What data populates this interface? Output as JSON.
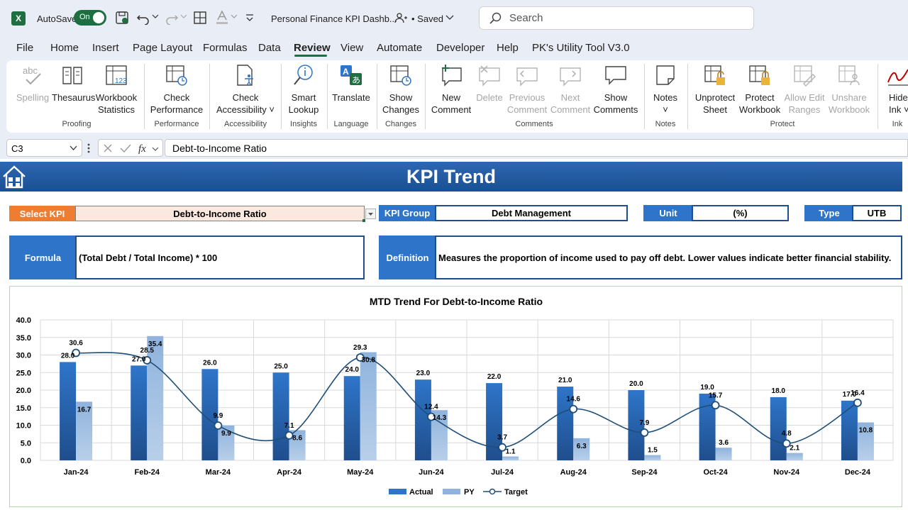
{
  "titlebar": {
    "autosave_label": "AutoSave",
    "toggle_label": "On",
    "file_title": "Personal Finance KPI Dashb...",
    "saved_label": "• Saved",
    "search_placeholder": "Search"
  },
  "menu": {
    "file": "File",
    "home": "Home",
    "insert": "Insert",
    "page_layout": "Page Layout",
    "formulas": "Formulas",
    "data": "Data",
    "review": "Review",
    "view": "View",
    "automate": "Automate",
    "developer": "Developer",
    "help": "Help",
    "utility": "PK's Utility Tool V3.0"
  },
  "ribbon": {
    "spelling": "Spelling",
    "thesaurus": "Thesaurus",
    "workbook_stats_1": "Workbook",
    "workbook_stats_2": "Statistics",
    "check_perf_1": "Check",
    "check_perf_2": "Performance",
    "check_acc_1": "Check",
    "check_acc_2": "Accessibility ˅",
    "smart_1": "Smart",
    "smart_2": "Lookup",
    "translate": "Translate",
    "show_changes_1": "Show",
    "show_changes_2": "Changes",
    "new_comment_1": "New",
    "new_comment_2": "Comment",
    "delete": "Delete",
    "previous_1": "Previous",
    "previous_2": "Comment",
    "next_1": "Next",
    "next_2": "Comment",
    "show_comments_1": "Show",
    "show_comments_2": "Comments",
    "notes_1": "Notes",
    "notes_2": "˅",
    "unprotect_1": "Unprotect",
    "unprotect_2": "Sheet",
    "protect_wb_1": "Protect",
    "protect_wb_2": "Workbook",
    "allow_edit_1": "Allow Edit",
    "allow_edit_2": "Ranges",
    "unshare_1": "Unshare",
    "unshare_2": "Workbook",
    "hide_ink_1": "Hide",
    "hide_ink_2": "Ink ˅",
    "groups": {
      "proofing": "Proofing",
      "performance": "Performance",
      "accessibility": "Accessibility",
      "insights": "Insights",
      "language": "Language",
      "changes": "Changes",
      "comments": "Comments",
      "notes": "Notes",
      "protect": "Protect",
      "ink": "Ink"
    }
  },
  "formula_bar": {
    "cell_ref": "C3",
    "content": "Debt-to-Income Ratio"
  },
  "dashboard": {
    "title": "KPI Trend",
    "select_kpi_label": "Select KPI",
    "select_kpi_value": "Debt-to-Income Ratio",
    "kpi_group_label": "KPI Group",
    "kpi_group_value": "Debt Management",
    "unit_label": "Unit",
    "unit_value": "(%)",
    "type_label": "Type",
    "type_value": "UTB",
    "formula_label": "Formula",
    "formula_value": "(Total Debt / Total Income) * 100",
    "definition_label": "Definition",
    "definition_value": "Measures the proportion of income used to pay off debt. Lower values indicate better financial stability."
  },
  "chart_data": {
    "type": "bar",
    "title": "MTD Trend For Debt-to-Income Ratio",
    "categories": [
      "Jan-24",
      "Feb-24",
      "Mar-24",
      "Apr-24",
      "May-24",
      "Jun-24",
      "Jul-24",
      "Aug-24",
      "Sep-24",
      "Oct-24",
      "Nov-24",
      "Dec-24"
    ],
    "series": [
      {
        "name": "Actual",
        "type": "bar",
        "color": "#2e75c9",
        "values": [
          28.0,
          27.0,
          26.0,
          25.0,
          24.0,
          23.0,
          22.0,
          21.0,
          20.0,
          19.0,
          18.0,
          17.0
        ]
      },
      {
        "name": "PY",
        "type": "bar",
        "color": "#8fb3dd",
        "values": [
          16.7,
          35.4,
          9.9,
          8.6,
          30.8,
          14.3,
          1.1,
          6.3,
          1.5,
          3.6,
          2.1,
          10.8
        ]
      },
      {
        "name": "Target",
        "type": "line",
        "color": "#1f4e79",
        "values": [
          30.6,
          28.5,
          9.9,
          7.1,
          29.3,
          12.4,
          3.7,
          14.6,
          7.9,
          15.7,
          4.8,
          16.4
        ]
      }
    ],
    "ylim": [
      0,
      40
    ],
    "yticks": [
      "0.0",
      "5.0",
      "10.0",
      "15.0",
      "20.0",
      "25.0",
      "30.0",
      "35.0",
      "40.0"
    ],
    "grid": true,
    "legend": "bottom"
  }
}
